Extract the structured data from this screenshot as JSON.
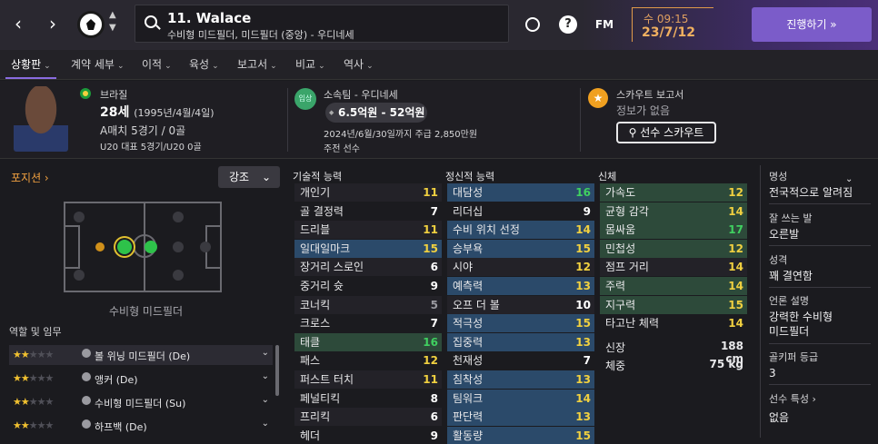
{
  "header": {
    "player_title": "11. Walace",
    "player_sub": "수비형 미드필더, 미드필더 (중앙) - 우디네세",
    "fm_label": "FM",
    "help_label": "?",
    "time": "수 09:15",
    "date": "23/7/12",
    "continue_label": "진행하기 »"
  },
  "tabs": [
    {
      "label": "상황판"
    },
    {
      "label": "계약 세부"
    },
    {
      "label": "이적"
    },
    {
      "label": "육성"
    },
    {
      "label": "보고서"
    },
    {
      "label": "비교"
    },
    {
      "label": "역사"
    }
  ],
  "info": {
    "nation": "브라질",
    "age": "28세",
    "dob": "(1995년/4월/4일)",
    "caps": "A매치 5경기 / 0골",
    "u20": "U20 대표 5경기/U20 0골",
    "club_label": "소속팀 - 우디네세",
    "club_status": "입상",
    "value": "6.5억원 - 52억원",
    "contract": "2024년/6월/30일까지 주급 2,850만원",
    "squad_status": "주전 선수",
    "scout_title": "스카우트 보고서",
    "scout_sub": "정보가 없음",
    "scout_button": "선수 스카우트"
  },
  "position": {
    "link": "포지션 ›",
    "dropdown": "강조",
    "label": "수비형 미드필더"
  },
  "roles": {
    "title": "역할 및 임무",
    "items": [
      {
        "name": "볼 위닝 미드필더 (De)",
        "stars": 2
      },
      {
        "name": "앵커 (De)",
        "stars": 2
      },
      {
        "name": "수비형 미드필더 (Su)",
        "stars": 2
      },
      {
        "name": "하프백 (De)",
        "stars": 2
      }
    ]
  },
  "technical": {
    "title": "기술적 능력",
    "rows": [
      {
        "name": "개인기",
        "value": "11"
      },
      {
        "name": "골 결정력",
        "value": "7"
      },
      {
        "name": "드리블",
        "value": "11"
      },
      {
        "name": "일대일마크",
        "value": "15"
      },
      {
        "name": "장거리 스로인",
        "value": "6"
      },
      {
        "name": "중거리 슛",
        "value": "9"
      },
      {
        "name": "코너킥",
        "value": "5"
      },
      {
        "name": "크로스",
        "value": "7"
      },
      {
        "name": "태클",
        "value": "16"
      },
      {
        "name": "패스",
        "value": "12"
      },
      {
        "name": "퍼스트 터치",
        "value": "11"
      },
      {
        "name": "페널티킥",
        "value": "8"
      },
      {
        "name": "프리킥",
        "value": "6"
      },
      {
        "name": "헤더",
        "value": "9"
      }
    ]
  },
  "mental": {
    "title": "정신적 능력",
    "rows": [
      {
        "name": "대담성",
        "value": "16"
      },
      {
        "name": "리더십",
        "value": "9"
      },
      {
        "name": "수비 위치 선정",
        "value": "14"
      },
      {
        "name": "승부욕",
        "value": "15"
      },
      {
        "name": "시야",
        "value": "12"
      },
      {
        "name": "예측력",
        "value": "13"
      },
      {
        "name": "오프 더 볼",
        "value": "10"
      },
      {
        "name": "적극성",
        "value": "15"
      },
      {
        "name": "집중력",
        "value": "13"
      },
      {
        "name": "천재성",
        "value": "7"
      },
      {
        "name": "침착성",
        "value": "13"
      },
      {
        "name": "팀워크",
        "value": "14"
      },
      {
        "name": "판단력",
        "value": "13"
      },
      {
        "name": "활동량",
        "value": "15"
      }
    ]
  },
  "physical": {
    "title": "신체",
    "rows": [
      {
        "name": "가속도",
        "value": "12"
      },
      {
        "name": "균형 감각",
        "value": "14"
      },
      {
        "name": "몸싸움",
        "value": "17"
      },
      {
        "name": "민첩성",
        "value": "12"
      },
      {
        "name": "점프 거리",
        "value": "14"
      },
      {
        "name": "주력",
        "value": "14"
      },
      {
        "name": "지구력",
        "value": "15"
      },
      {
        "name": "타고난 체력",
        "value": "14"
      }
    ],
    "height_label": "신장",
    "height": "188 cm",
    "weight_label": "체중",
    "weight": "75 kg"
  },
  "right_panel": {
    "fame_title": "명성",
    "fame": "전국적으로 알려짐",
    "foot_title": "잘 쓰는 발",
    "foot": "오른발",
    "personality_title": "성격",
    "personality": "꽤 결연함",
    "media_title": "언론 설명",
    "media_1": "강력한 수비형",
    "media_2": "미드필더",
    "gk_title": "골키퍼 등급",
    "gk": "3",
    "traits_title": "선수 특성 ›",
    "traits": "없음"
  }
}
